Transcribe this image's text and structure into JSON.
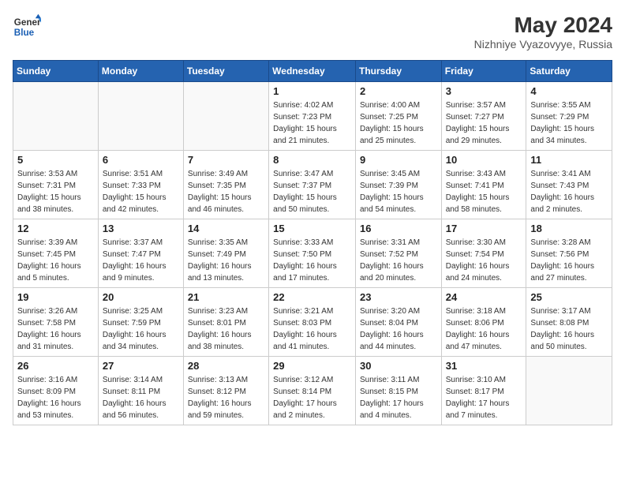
{
  "header": {
    "logo_line1": "General",
    "logo_line2": "Blue",
    "month_year": "May 2024",
    "location": "Nizhniye Vyazovyye, Russia"
  },
  "days_of_week": [
    "Sunday",
    "Monday",
    "Tuesday",
    "Wednesday",
    "Thursday",
    "Friday",
    "Saturday"
  ],
  "weeks": [
    [
      {
        "day": "",
        "info": ""
      },
      {
        "day": "",
        "info": ""
      },
      {
        "day": "",
        "info": ""
      },
      {
        "day": "1",
        "info": "Sunrise: 4:02 AM\nSunset: 7:23 PM\nDaylight: 15 hours\nand 21 minutes."
      },
      {
        "day": "2",
        "info": "Sunrise: 4:00 AM\nSunset: 7:25 PM\nDaylight: 15 hours\nand 25 minutes."
      },
      {
        "day": "3",
        "info": "Sunrise: 3:57 AM\nSunset: 7:27 PM\nDaylight: 15 hours\nand 29 minutes."
      },
      {
        "day": "4",
        "info": "Sunrise: 3:55 AM\nSunset: 7:29 PM\nDaylight: 15 hours\nand 34 minutes."
      }
    ],
    [
      {
        "day": "5",
        "info": "Sunrise: 3:53 AM\nSunset: 7:31 PM\nDaylight: 15 hours\nand 38 minutes."
      },
      {
        "day": "6",
        "info": "Sunrise: 3:51 AM\nSunset: 7:33 PM\nDaylight: 15 hours\nand 42 minutes."
      },
      {
        "day": "7",
        "info": "Sunrise: 3:49 AM\nSunset: 7:35 PM\nDaylight: 15 hours\nand 46 minutes."
      },
      {
        "day": "8",
        "info": "Sunrise: 3:47 AM\nSunset: 7:37 PM\nDaylight: 15 hours\nand 50 minutes."
      },
      {
        "day": "9",
        "info": "Sunrise: 3:45 AM\nSunset: 7:39 PM\nDaylight: 15 hours\nand 54 minutes."
      },
      {
        "day": "10",
        "info": "Sunrise: 3:43 AM\nSunset: 7:41 PM\nDaylight: 15 hours\nand 58 minutes."
      },
      {
        "day": "11",
        "info": "Sunrise: 3:41 AM\nSunset: 7:43 PM\nDaylight: 16 hours\nand 2 minutes."
      }
    ],
    [
      {
        "day": "12",
        "info": "Sunrise: 3:39 AM\nSunset: 7:45 PM\nDaylight: 16 hours\nand 5 minutes."
      },
      {
        "day": "13",
        "info": "Sunrise: 3:37 AM\nSunset: 7:47 PM\nDaylight: 16 hours\nand 9 minutes."
      },
      {
        "day": "14",
        "info": "Sunrise: 3:35 AM\nSunset: 7:49 PM\nDaylight: 16 hours\nand 13 minutes."
      },
      {
        "day": "15",
        "info": "Sunrise: 3:33 AM\nSunset: 7:50 PM\nDaylight: 16 hours\nand 17 minutes."
      },
      {
        "day": "16",
        "info": "Sunrise: 3:31 AM\nSunset: 7:52 PM\nDaylight: 16 hours\nand 20 minutes."
      },
      {
        "day": "17",
        "info": "Sunrise: 3:30 AM\nSunset: 7:54 PM\nDaylight: 16 hours\nand 24 minutes."
      },
      {
        "day": "18",
        "info": "Sunrise: 3:28 AM\nSunset: 7:56 PM\nDaylight: 16 hours\nand 27 minutes."
      }
    ],
    [
      {
        "day": "19",
        "info": "Sunrise: 3:26 AM\nSunset: 7:58 PM\nDaylight: 16 hours\nand 31 minutes."
      },
      {
        "day": "20",
        "info": "Sunrise: 3:25 AM\nSunset: 7:59 PM\nDaylight: 16 hours\nand 34 minutes."
      },
      {
        "day": "21",
        "info": "Sunrise: 3:23 AM\nSunset: 8:01 PM\nDaylight: 16 hours\nand 38 minutes."
      },
      {
        "day": "22",
        "info": "Sunrise: 3:21 AM\nSunset: 8:03 PM\nDaylight: 16 hours\nand 41 minutes."
      },
      {
        "day": "23",
        "info": "Sunrise: 3:20 AM\nSunset: 8:04 PM\nDaylight: 16 hours\nand 44 minutes."
      },
      {
        "day": "24",
        "info": "Sunrise: 3:18 AM\nSunset: 8:06 PM\nDaylight: 16 hours\nand 47 minutes."
      },
      {
        "day": "25",
        "info": "Sunrise: 3:17 AM\nSunset: 8:08 PM\nDaylight: 16 hours\nand 50 minutes."
      }
    ],
    [
      {
        "day": "26",
        "info": "Sunrise: 3:16 AM\nSunset: 8:09 PM\nDaylight: 16 hours\nand 53 minutes."
      },
      {
        "day": "27",
        "info": "Sunrise: 3:14 AM\nSunset: 8:11 PM\nDaylight: 16 hours\nand 56 minutes."
      },
      {
        "day": "28",
        "info": "Sunrise: 3:13 AM\nSunset: 8:12 PM\nDaylight: 16 hours\nand 59 minutes."
      },
      {
        "day": "29",
        "info": "Sunrise: 3:12 AM\nSunset: 8:14 PM\nDaylight: 17 hours\nand 2 minutes."
      },
      {
        "day": "30",
        "info": "Sunrise: 3:11 AM\nSunset: 8:15 PM\nDaylight: 17 hours\nand 4 minutes."
      },
      {
        "day": "31",
        "info": "Sunrise: 3:10 AM\nSunset: 8:17 PM\nDaylight: 17 hours\nand 7 minutes."
      },
      {
        "day": "",
        "info": ""
      }
    ]
  ]
}
